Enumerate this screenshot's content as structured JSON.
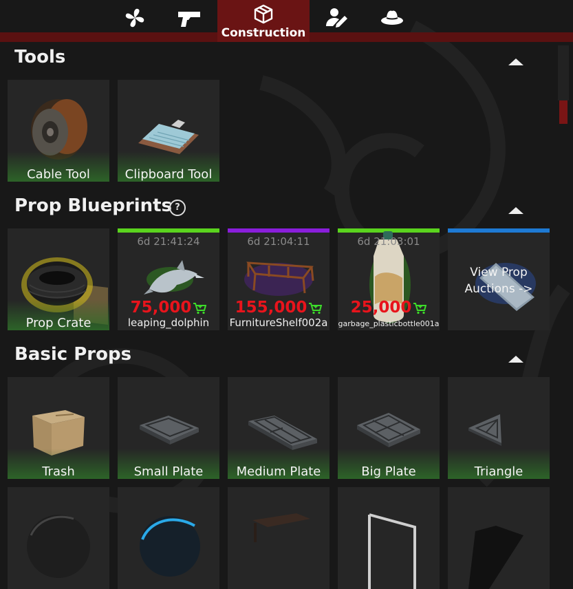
{
  "tabs": [
    {
      "icon": "pinwheel-icon"
    },
    {
      "icon": "pistol-icon"
    },
    {
      "icon": "box-icon",
      "label": "Construction",
      "active": true
    },
    {
      "icon": "user-edit-icon"
    },
    {
      "icon": "hat-icon"
    }
  ],
  "sections": {
    "tools": {
      "title": "Tools",
      "items": [
        {
          "label": "Cable Tool"
        },
        {
          "label": "Clipboard Tool"
        }
      ]
    },
    "blueprints": {
      "title": "Prop Blueprints",
      "help": "?",
      "crate": {
        "label": "Prop Crate"
      },
      "items": [
        {
          "timer": "6d 21:41:24",
          "price": "75,000",
          "name": "leaping_dolphin",
          "bar_color": "#5ad41e"
        },
        {
          "timer": "6d 21:04:11",
          "price": "155,000",
          "name": "FurnitureShelf002a",
          "bar_color": "#8a1edb"
        },
        {
          "timer": "6d 21:03:01",
          "price": "25,000",
          "name": "garbage_plasticbottle001a",
          "bar_color": "#5ad41e"
        }
      ],
      "auction": {
        "line1": "View Prop",
        "line2": "Auctions ->",
        "bar_color": "#1e7ad4"
      }
    },
    "basic": {
      "title": "Basic Props",
      "items": [
        {
          "label": "Trash"
        },
        {
          "label": "Small Plate"
        },
        {
          "label": "Medium Plate"
        },
        {
          "label": "Big Plate"
        },
        {
          "label": "Triangle"
        }
      ]
    }
  },
  "colors": {
    "accent": "#6a1414",
    "price": "#e8141c",
    "cart": "#3ddc2a"
  }
}
